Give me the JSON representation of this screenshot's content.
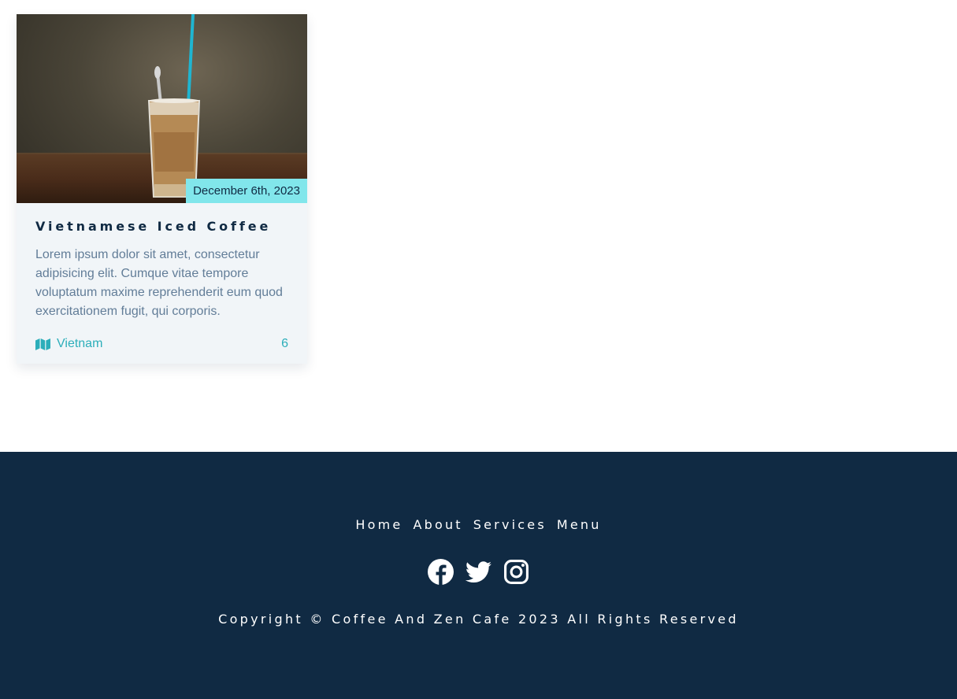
{
  "card": {
    "image_alt": "Vietnamese Iced Coffee",
    "date": "December 6th, 2023",
    "title": "Vietnamese Iced Coffee",
    "text": "Lorem ipsum dolor sit amet, consectetur adipisicing elit. Cumque vitae tempore voluptatum maxime reprehenderit eum quod exercitationem fugit, qui corporis.",
    "location": "Vietnam",
    "count": "6",
    "location_icon": "map-icon"
  },
  "footer": {
    "links": [
      "Home",
      "About",
      "Services",
      "Menu"
    ],
    "social_icons": [
      "facebook-icon",
      "twitter-icon",
      "instagram-icon"
    ],
    "copyright": "Copyright © Coffee And Zen Cafe 2023 All Rights Reserved"
  },
  "colors": {
    "primary_dark": "#102a43",
    "accent": "#2caeba",
    "badge": "#81e6eb",
    "card_bg": "#f1f5f8",
    "body_text": "#627d98"
  }
}
